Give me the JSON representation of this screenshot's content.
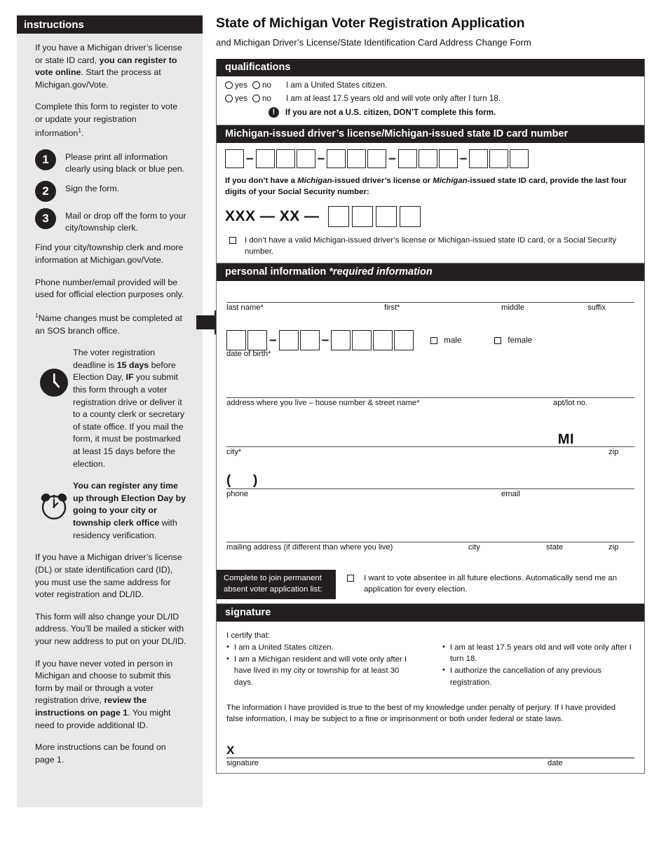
{
  "sidebar": {
    "header": "instructions",
    "intro": {
      "p1_a": "If you have a Michigan driver’s license or state ID card, ",
      "p1_bold": "you can register to vote online",
      "p1_b": ". Start the process at Michigan.gov/Vote.",
      "p2": "Complete this form to register to vote or update your registration information",
      "p2_sup": "1"
    },
    "steps": [
      {
        "number": "1",
        "text": "Please print all information clearly using black or blue pen."
      },
      {
        "number": "2",
        "text": "Sign the form."
      },
      {
        "number": "3",
        "text": "Mail or drop off the form to your city/township clerk."
      }
    ],
    "find_clerk": "Find your city/township clerk and more information at Michigan.gov/Vote.",
    "phone_note": "Phone number/email provided will be used for official election purposes only.",
    "footnote_sup": "1",
    "footnote": "Name changes must be completed at an SOS branch office.",
    "clock_note": {
      "a": "The voter registration deadline is ",
      "bold1": "15 days",
      "b": " before Election Day, ",
      "bold2": "IF",
      "c": " you submit this form through a voter registration drive or deliver it to a county clerk or secretary of state office. If you mail the form, it must be postmarked at least 15 days before the election."
    },
    "alarm_note": {
      "bold": "You can register any time up through Election Day by going to your city or township clerk office",
      "rest": " with residency verification."
    },
    "dl_address": "If you have a Michigan driver’s license (DL) or state identification card (ID), you must use the same address for voter registration and DL/ID.",
    "sticker": "This form will also change your DL/ID address. You’ll be mailed a sticker with your new address to put on your DL/ID.",
    "never_voted": {
      "a": "If you have never voted in person in Michigan and choose to submit this form by mail or through a voter registration drive, ",
      "bold": "review the instructions on page 1",
      "b": ". You might need to provide additional ID."
    },
    "more": "More instructions can be found on page 1."
  },
  "document": {
    "title": "State of Michigan Voter Registration Application",
    "subtitle": "and Michigan Driver’s License/State Identification Card Address Change Form"
  },
  "qualifications": {
    "header": "qualifications",
    "yes_label": "yes",
    "no_label": "no",
    "items": [
      "I am a United States citizen.",
      "I am at least 17.5 years old and will vote only after I turn 18."
    ],
    "warning": "If you are not a U.S. citizen, DON’T complete this form.",
    "warning_icon_glyph": "!"
  },
  "license": {
    "header": "Michigan-issued driver’s license/Michigan-issued state ID card number",
    "box_groups": [
      1,
      3,
      3,
      3,
      3
    ],
    "note_a": "If you don’t have a ",
    "note_italic1": "Michigan",
    "note_b": "-issued driver’s license or ",
    "note_italic2": "Michigan",
    "note_c": "-issued state ID card, provide the last four digits of your Social Security number:",
    "ssn_prefix": "XXX — XX —",
    "ssn_boxes": 4,
    "no_id_checkbox": "I don’t have a valid Michigan-issued driver’s license or Michigan-issued state ID card, or a Social Security number."
  },
  "personal": {
    "header_main": "personal information ",
    "header_required": "*required information",
    "name_labels": {
      "last": "last name*",
      "first": "first*",
      "middle": "middle",
      "suffix": "suffix"
    },
    "dob_label": "date of birth*",
    "dob_groups": [
      2,
      2,
      4
    ],
    "male": "male",
    "female": "female",
    "address_label": "address where you live – house number & street name*",
    "apt_label": "apt/lot no.",
    "city_label": "city*",
    "state_value": "MI",
    "zip_label": "zip",
    "phone_label": "phone",
    "phone_paren_open": "(",
    "phone_paren_close": ")",
    "email_label": "email",
    "mailing_label": "mailing address (if different than where you live)",
    "mailing_city_label": "city",
    "mailing_state_label": "state",
    "mailing_zip_label": "zip"
  },
  "absentee": {
    "black_label": "Complete to join permanent absent voter application list:",
    "checkbox_text": "I want to vote absentee in all future elections. Automatically send me an application for every election."
  },
  "signature": {
    "header": "signature",
    "certify_intro": "I certify that:",
    "bullets_left": [
      "I am a United States citizen.",
      "I am a Michigan resident and will vote only after I have lived in my city or township for at least 30 days."
    ],
    "bullets_right": [
      "I am at least 17.5 years old and will vote only after I turn 18.",
      "I authorize the cancellation of any previous registration."
    ],
    "perjury": "The information I have provided is true to the best of my knowledge under penalty of perjury. If I have provided false information, I may be subject to a fine or imprisonment or both under federal or state laws.",
    "x_mark": "X",
    "signature_label": "signature",
    "date_label": "date"
  },
  "colors": {
    "black_bar": "#231f20",
    "sidebar_bg": "#e9e9e9",
    "rule": "#4a4a4a"
  }
}
